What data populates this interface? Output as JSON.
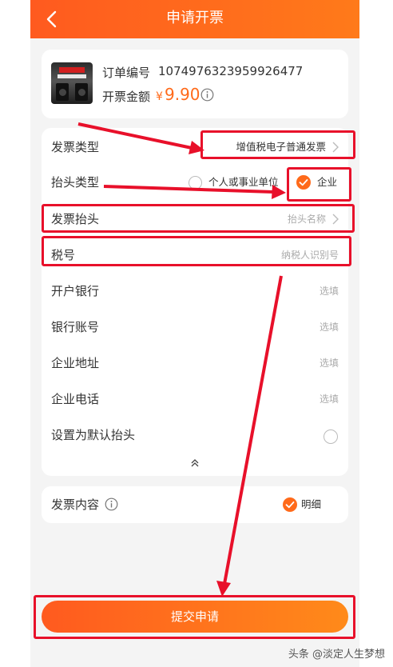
{
  "header": {
    "title": "申请开票"
  },
  "order": {
    "number_label": "订单编号",
    "number_value": "1074976323959926477",
    "amount_label": "开票金额",
    "currency": "¥",
    "amount_value": "9.90"
  },
  "form": {
    "invoice_type": {
      "label": "发票类型",
      "value": "增值税电子普通发票"
    },
    "header_type": {
      "label": "抬头类型",
      "options": [
        {
          "label": "个人或事业单位",
          "selected": false
        },
        {
          "label": "企业",
          "selected": true
        }
      ]
    },
    "invoice_header": {
      "label": "发票抬头",
      "placeholder": "抬头名称"
    },
    "tax_number": {
      "label": "税号",
      "placeholder": "纳税人识别号"
    },
    "bank": {
      "label": "开户银行",
      "placeholder": "选填"
    },
    "account": {
      "label": "银行账号",
      "placeholder": "选填"
    },
    "address": {
      "label": "企业地址",
      "placeholder": "选填"
    },
    "phone": {
      "label": "企业电话",
      "placeholder": "选填"
    },
    "default_header": {
      "label": "设置为默认抬头",
      "checked": false
    }
  },
  "content": {
    "label": "发票内容",
    "option": "明细",
    "selected": true
  },
  "submit": {
    "label": "提交申请"
  },
  "watermark": "头条 @淡定人生梦想",
  "colors": {
    "accent": "#ff6a1a",
    "annotation": "#e8102a"
  }
}
